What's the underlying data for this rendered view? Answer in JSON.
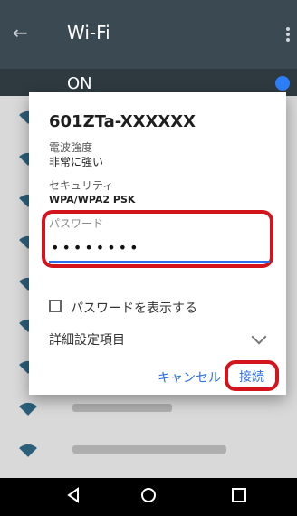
{
  "appbar": {
    "title": "Wi-Fi",
    "back_icon": "arrow-left-icon",
    "menu_icon": "more-vert-icon"
  },
  "status": {
    "on_label": "ON"
  },
  "dialog": {
    "ssid": "601ZTa-XXXXXX",
    "signal_label": "電波強度",
    "signal_value": "非常に強い",
    "security_label": "セキュリティ",
    "security_value": "WPA/WPA2 PSK",
    "password_label": "パスワード",
    "password_value": "••••••••",
    "show_password_label": "パスワードを表示する",
    "advanced_label": "詳細設定項目",
    "cancel_label": "キャンセル",
    "connect_label": "接続"
  },
  "colors": {
    "appbar": "#3b4a52",
    "accent_blue": "#2a6fe8",
    "highlight_red": "#d3141c"
  },
  "nav": {
    "back_icon": "triangle-left-icon",
    "home_icon": "circle-home-icon",
    "recent_icon": "square-recent-icon"
  }
}
